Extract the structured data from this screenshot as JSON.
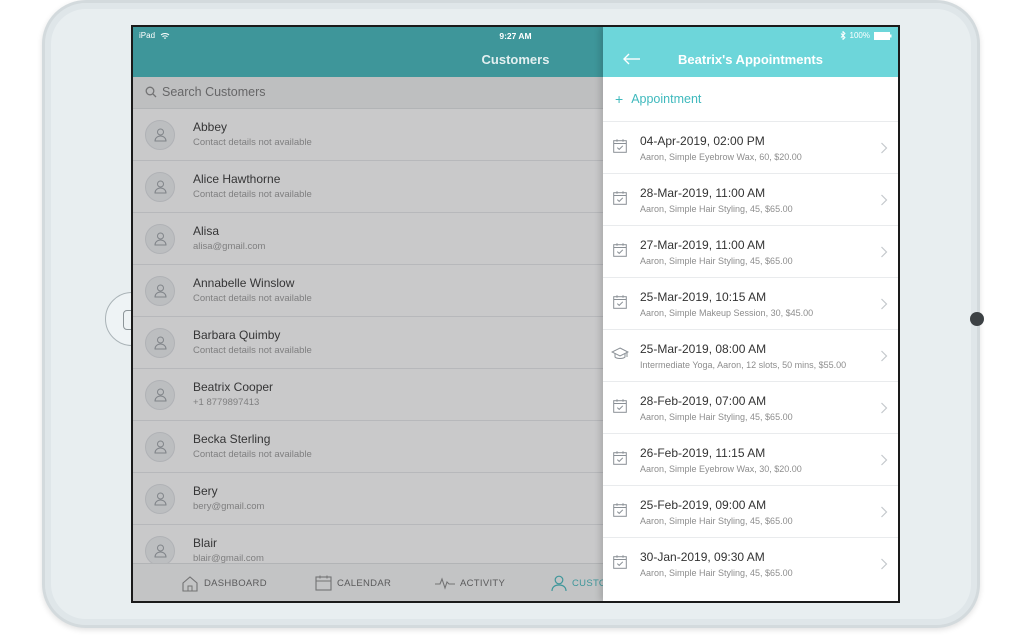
{
  "status_bar": {
    "device": "iPad",
    "time": "9:27 AM",
    "battery": "100%"
  },
  "left": {
    "title": "Customers",
    "search_placeholder": "Search Customers",
    "customers": [
      {
        "name": "Abbey",
        "detail": "Contact details not available"
      },
      {
        "name": "Alice Hawthorne",
        "detail": "Contact details not available"
      },
      {
        "name": "Alisa",
        "detail": "alisa@gmail.com"
      },
      {
        "name": "Annabelle Winslow",
        "detail": "Contact details not available"
      },
      {
        "name": "Barbara Quimby",
        "detail": "Contact details not available"
      },
      {
        "name": "Beatrix Cooper",
        "detail": "+1 8779897413"
      },
      {
        "name": "Becka Sterling",
        "detail": "Contact details not available"
      },
      {
        "name": "Bery",
        "detail": "bery@gmail.com"
      },
      {
        "name": "Blair",
        "detail": "blair@gmail.com"
      }
    ],
    "tabs": {
      "dashboard": "DASHBOARD",
      "calendar": "CALENDAR",
      "activity": "ACTIVITY",
      "customers": "CUSTOMERS"
    }
  },
  "right": {
    "title": "Beatrix's Appointments",
    "add_label": "Appointment",
    "appointments": [
      {
        "date": "04-Apr-2019, 02:00 PM",
        "detail": "Aaron, Simple Eyebrow Wax, 60, $20.00",
        "icon": "calendar-check-icon"
      },
      {
        "date": "28-Mar-2019, 11:00 AM",
        "detail": "Aaron, Simple Hair Styling, 45, $65.00",
        "icon": "calendar-check-icon"
      },
      {
        "date": "27-Mar-2019, 11:00 AM",
        "detail": "Aaron, Simple Hair Styling, 45, $65.00",
        "icon": "calendar-check-icon"
      },
      {
        "date": "25-Mar-2019, 10:15 AM",
        "detail": "Aaron, Simple Makeup Session, 30, $45.00",
        "icon": "calendar-check-icon"
      },
      {
        "date": "25-Mar-2019, 08:00 AM",
        "detail": "Intermediate Yoga, Aaron, 12 slots, 50 mins, $55.00",
        "icon": "graduation-cap-icon"
      },
      {
        "date": "28-Feb-2019, 07:00 AM",
        "detail": "Aaron, Simple Hair Styling, 45, $65.00",
        "icon": "calendar-check-icon"
      },
      {
        "date": "26-Feb-2019, 11:15 AM",
        "detail": "Aaron, Simple Eyebrow Wax, 30, $20.00",
        "icon": "calendar-check-icon"
      },
      {
        "date": "25-Feb-2019, 09:00 AM",
        "detail": "Aaron, Simple Hair Styling, 45, $65.00",
        "icon": "calendar-check-icon"
      },
      {
        "date": "30-Jan-2019, 09:30 AM",
        "detail": "Aaron, Simple Hair Styling, 45, $65.00",
        "icon": "calendar-check-icon"
      }
    ]
  },
  "colors": {
    "teal": "#3fb9bd",
    "teal_light": "#6dd6da"
  }
}
